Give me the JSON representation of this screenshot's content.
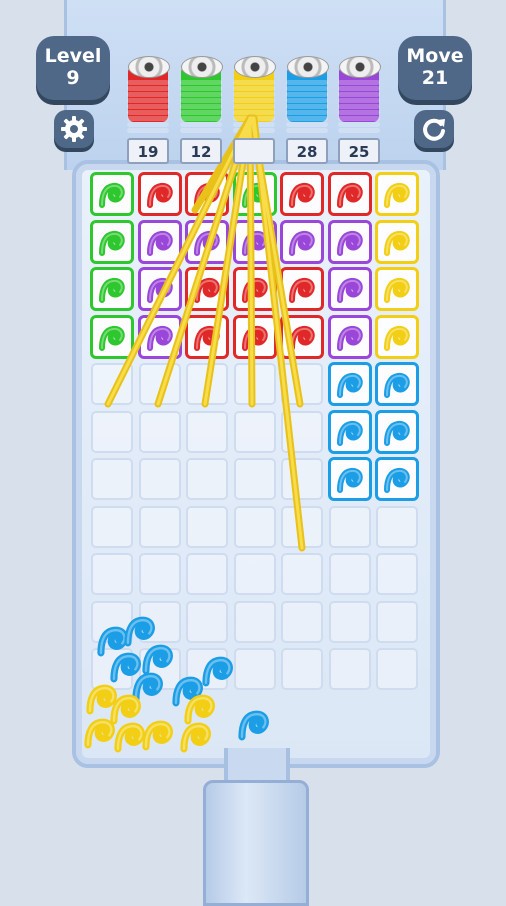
{
  "hud": {
    "level_label": "Level",
    "level_value": "9",
    "move_label": "Move",
    "move_value": "21"
  },
  "spools": [
    {
      "color": "red",
      "hex": "#e02828",
      "count": "19"
    },
    {
      "color": "green",
      "hex": "#2ec82e",
      "count": "12"
    },
    {
      "color": "yellow",
      "hex": "#f2cf14",
      "count": ""
    },
    {
      "color": "blue",
      "hex": "#1c9ee6",
      "count": "28"
    },
    {
      "color": "purple",
      "hex": "#9a46d8",
      "count": "25"
    }
  ],
  "colors": {
    "green": "#2ec82e",
    "red": "#e02828",
    "purple": "#9a46d8",
    "yellow": "#f2cf14",
    "blue": "#1c9ee6"
  },
  "grid": {
    "rows": [
      [
        "green",
        "red",
        "red",
        "green",
        "red",
        "red",
        "yellow"
      ],
      [
        "green",
        "purple",
        "purple",
        "purple",
        "purple",
        "purple",
        "yellow"
      ],
      [
        "green",
        "purple",
        "red",
        "red",
        "red",
        "purple",
        "yellow"
      ],
      [
        "green",
        "purple",
        "red",
        "red",
        "red",
        "purple",
        "yellow"
      ],
      [
        "",
        "",
        "",
        "",
        "",
        "blue",
        "blue"
      ],
      [
        "",
        "",
        "",
        "",
        "",
        "blue",
        "blue"
      ],
      [
        "",
        "",
        "",
        "",
        "",
        "blue",
        "blue"
      ],
      [
        "",
        "",
        "",
        "",
        "",
        "",
        ""
      ],
      [
        "",
        "",
        "",
        "",
        "",
        "",
        ""
      ],
      [
        "",
        "",
        "",
        "",
        "",
        "",
        ""
      ],
      [
        "",
        "",
        "",
        "",
        "",
        "",
        ""
      ]
    ]
  },
  "icons": {
    "settings": "gear-icon",
    "restart": "restart-icon"
  }
}
